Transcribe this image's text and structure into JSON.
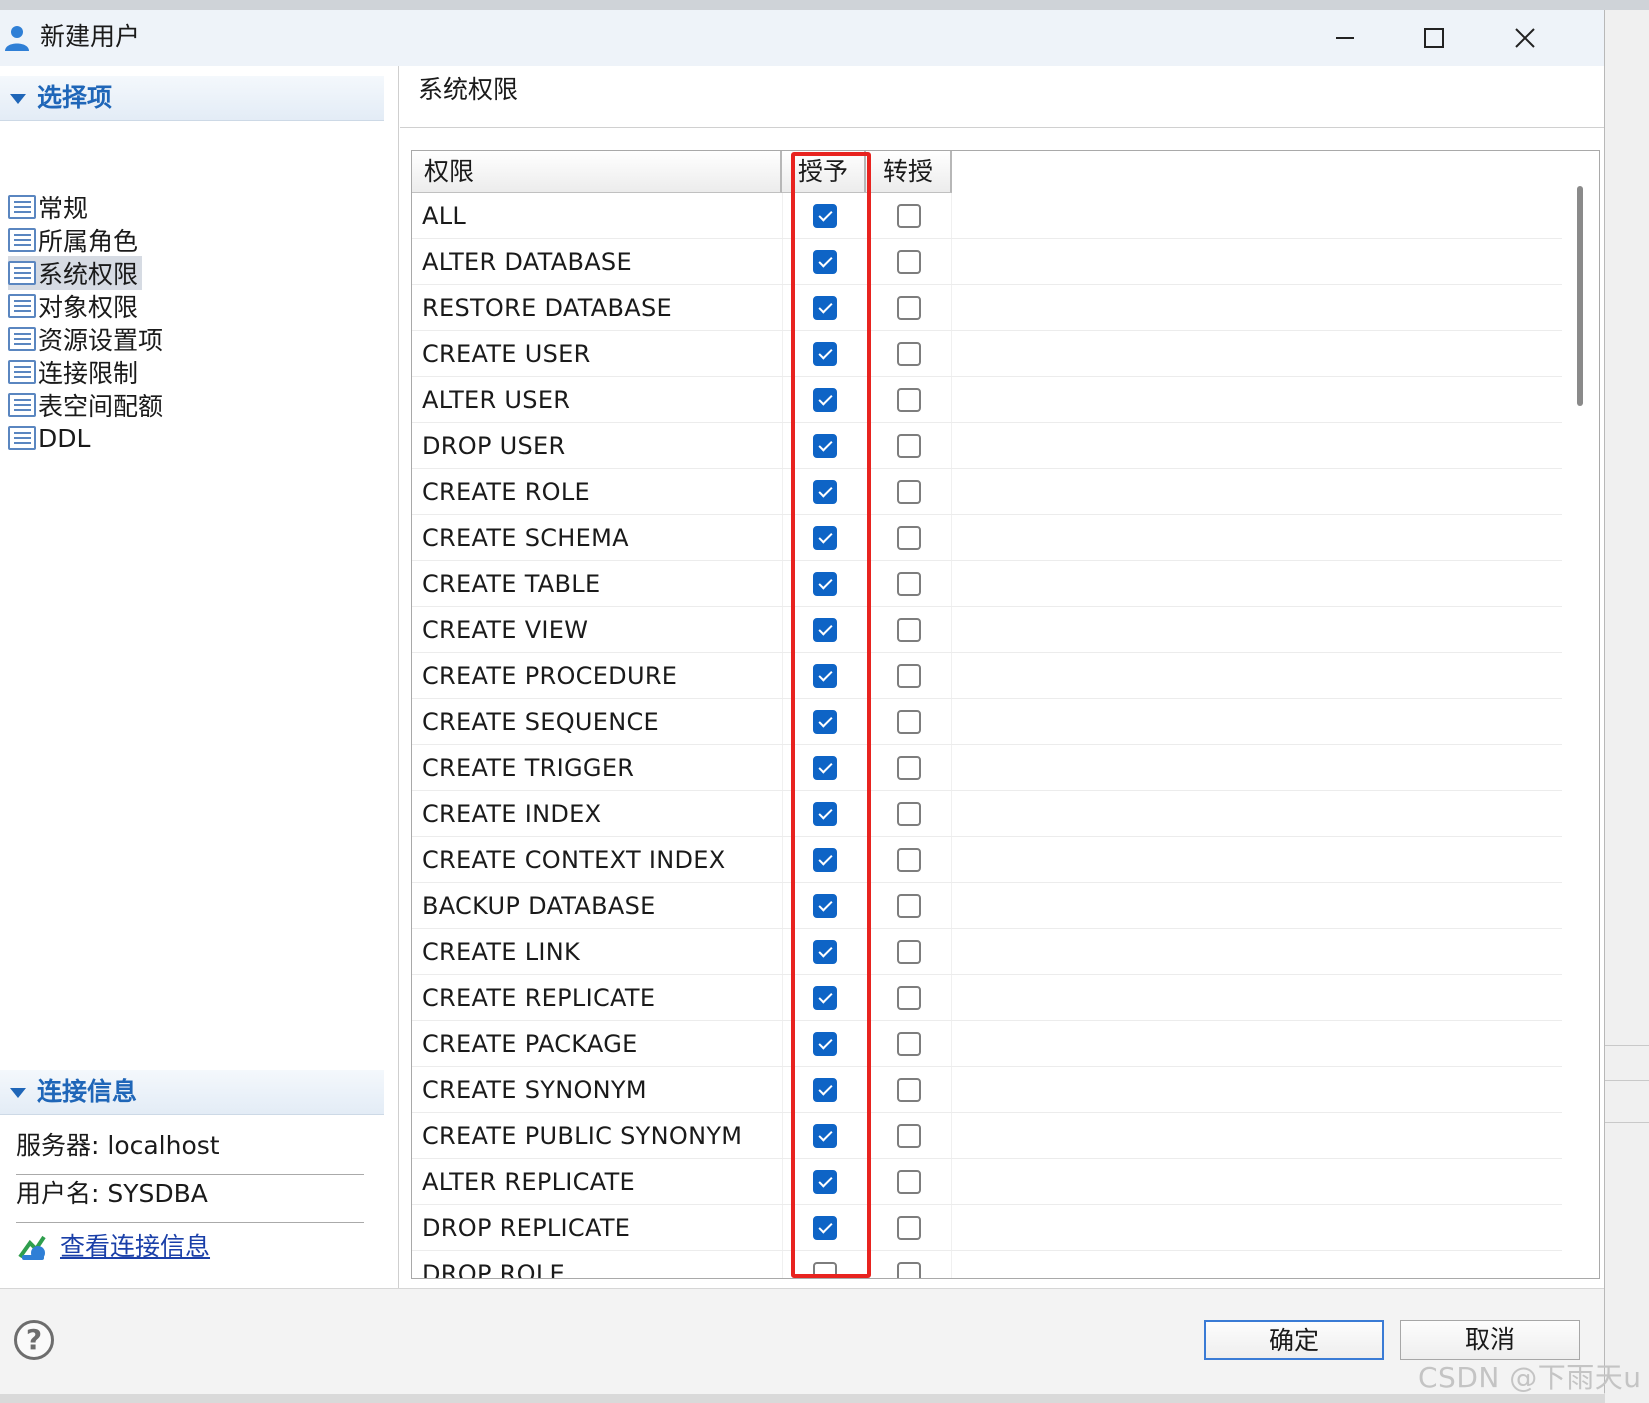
{
  "window": {
    "title": "新建用户"
  },
  "nav": {
    "header": "选择项",
    "items": [
      {
        "label": "常规",
        "selected": false
      },
      {
        "label": "所属角色",
        "selected": false
      },
      {
        "label": "系统权限",
        "selected": true
      },
      {
        "label": "对象权限",
        "selected": false
      },
      {
        "label": "资源设置项",
        "selected": false
      },
      {
        "label": "连接限制",
        "selected": false
      },
      {
        "label": "表空间配额",
        "selected": false
      },
      {
        "label": "DDL",
        "selected": false
      }
    ]
  },
  "connection": {
    "header": "连接信息",
    "server": "服务器: localhost",
    "username": "用户名: SYSDBA",
    "link": "查看连接信息"
  },
  "panel": {
    "title": "系统权限"
  },
  "table": {
    "headers": {
      "privilege": "权限",
      "grant": "授予",
      "transfer": "转授"
    },
    "rows": [
      {
        "name": "ALL",
        "grant": true,
        "transfer": false
      },
      {
        "name": "ALTER DATABASE",
        "grant": true,
        "transfer": false
      },
      {
        "name": "RESTORE DATABASE",
        "grant": true,
        "transfer": false
      },
      {
        "name": "CREATE USER",
        "grant": true,
        "transfer": false
      },
      {
        "name": "ALTER USER",
        "grant": true,
        "transfer": false
      },
      {
        "name": "DROP USER",
        "grant": true,
        "transfer": false
      },
      {
        "name": "CREATE ROLE",
        "grant": true,
        "transfer": false
      },
      {
        "name": "CREATE SCHEMA",
        "grant": true,
        "transfer": false
      },
      {
        "name": "CREATE TABLE",
        "grant": true,
        "transfer": false
      },
      {
        "name": "CREATE VIEW",
        "grant": true,
        "transfer": false
      },
      {
        "name": "CREATE PROCEDURE",
        "grant": true,
        "transfer": false
      },
      {
        "name": "CREATE SEQUENCE",
        "grant": true,
        "transfer": false
      },
      {
        "name": "CREATE TRIGGER",
        "grant": true,
        "transfer": false
      },
      {
        "name": "CREATE INDEX",
        "grant": true,
        "transfer": false
      },
      {
        "name": "CREATE CONTEXT INDEX",
        "grant": true,
        "transfer": false
      },
      {
        "name": "BACKUP DATABASE",
        "grant": true,
        "transfer": false
      },
      {
        "name": "CREATE LINK",
        "grant": true,
        "transfer": false
      },
      {
        "name": "CREATE REPLICATE",
        "grant": true,
        "transfer": false
      },
      {
        "name": "CREATE PACKAGE",
        "grant": true,
        "transfer": false
      },
      {
        "name": "CREATE SYNONYM",
        "grant": true,
        "transfer": false
      },
      {
        "name": "CREATE PUBLIC SYNONYM",
        "grant": true,
        "transfer": false
      },
      {
        "name": "ALTER REPLICATE",
        "grant": true,
        "transfer": false
      },
      {
        "name": "DROP REPLICATE",
        "grant": true,
        "transfer": false
      },
      {
        "name": "DROP ROLE",
        "grant": false,
        "transfer": false
      }
    ]
  },
  "footer": {
    "ok": "确定",
    "cancel": "取消",
    "help": "?"
  },
  "watermark": "CSDN @下雨天u",
  "colors": {
    "accent": "#0e64c6",
    "highlight": "#e8231f",
    "section": "#1f66b8"
  },
  "icons": [
    "user-icon",
    "minimize-icon",
    "maximize-icon",
    "close-icon",
    "list-icon",
    "connection-icon",
    "help-icon"
  ]
}
